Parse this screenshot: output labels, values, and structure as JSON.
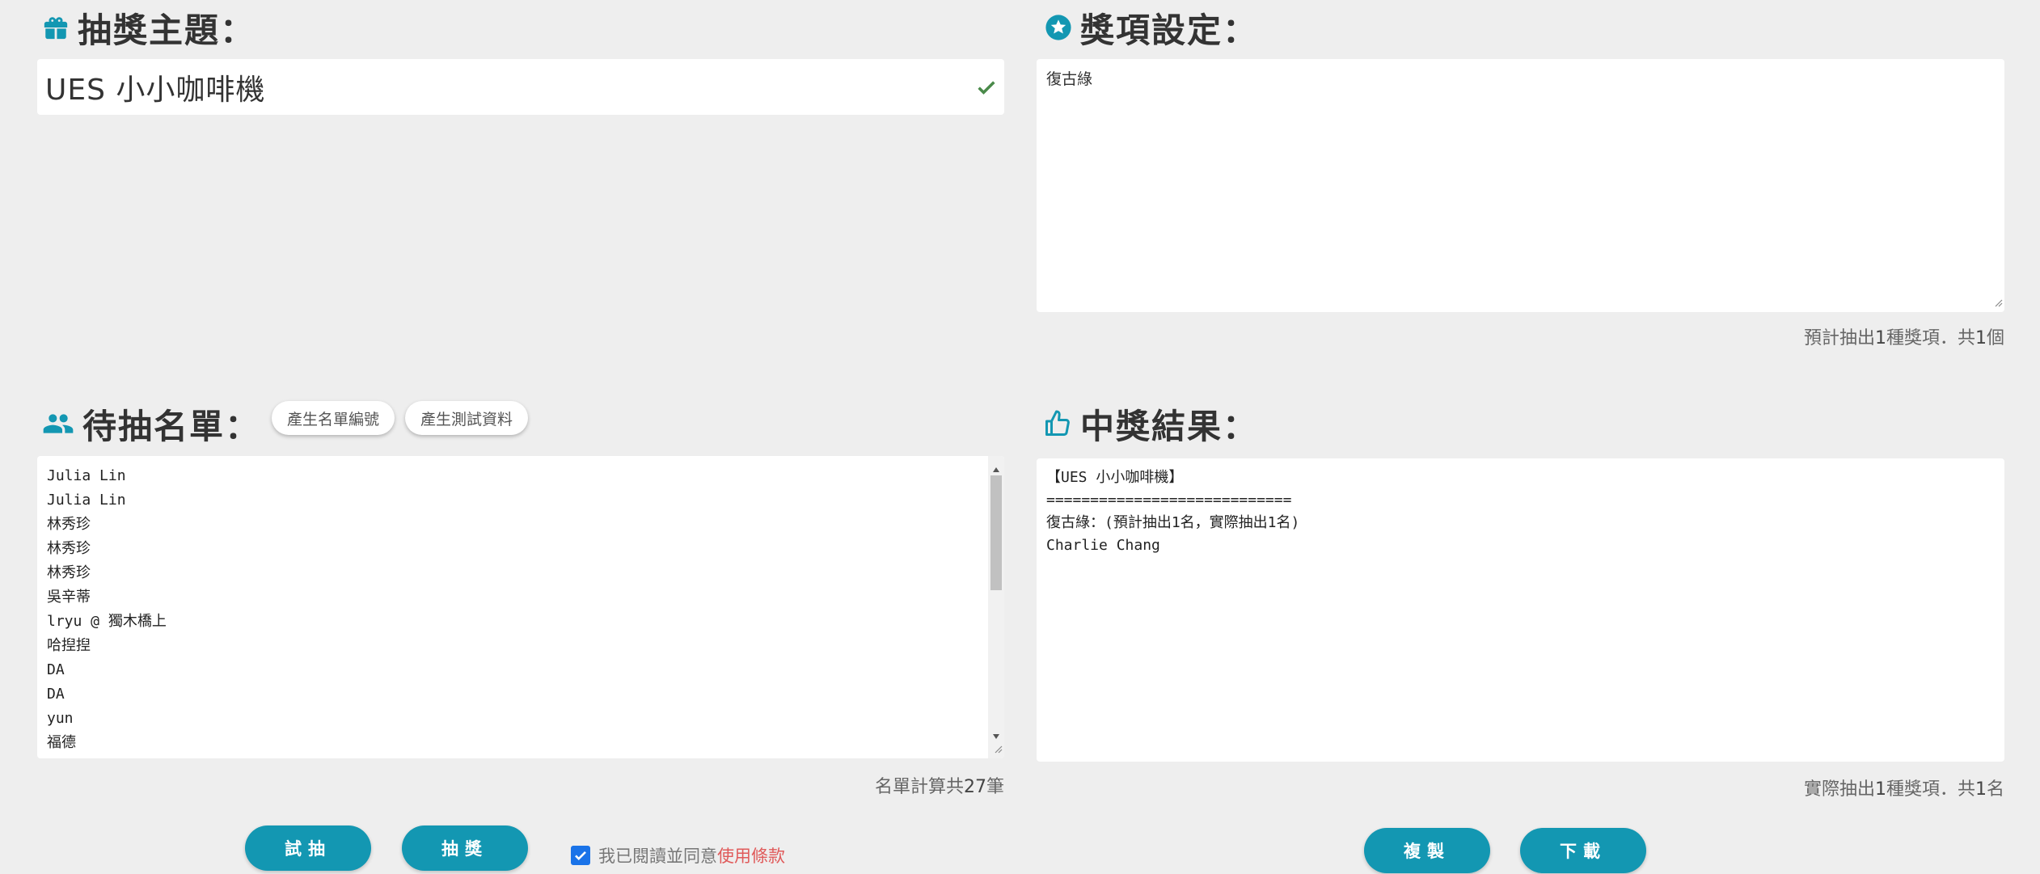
{
  "topic": {
    "heading": "抽獎主題：",
    "value": "UES 小小咖啡機"
  },
  "prizes": {
    "heading": "獎項設定：",
    "text": "復古綠",
    "summary_pre": "預計抽出",
    "summary_kinds": "1",
    "summary_mid": "種獎項．共",
    "summary_count": "1",
    "summary_post": "個"
  },
  "candidates": {
    "heading": "待抽名單：",
    "gen_numbers_label": "產生名單編號",
    "gen_test_label": "產生測試資料",
    "items": [
      "Julia Lin",
      "Julia Lin",
      "林秀珍",
      "林秀珍",
      "林秀珍",
      "吳辛蒂",
      "lryu @ 獨木橋上",
      "哈揑揑",
      "DA",
      "DA",
      "yun",
      "福德"
    ],
    "count_pre": "名單計算共",
    "count": "27",
    "count_post": "筆"
  },
  "results": {
    "heading": "中獎結果：",
    "lines": [
      "【UES 小小咖啡機】",
      "============================",
      "復古綠：(預計抽出1名，實際抽出1名)",
      "Charlie Chang"
    ],
    "summary_pre": "實際抽出",
    "summary_kinds": "1",
    "summary_mid": "種獎項．共",
    "summary_count": "1",
    "summary_post": "名"
  },
  "actions": {
    "trial_label": "試抽",
    "draw_label": "抽獎",
    "agree_text": "我已閱讀並同意",
    "terms_link": "使用條款",
    "agree_checked": true,
    "copy_label": "複製",
    "download_label": "下載"
  },
  "colors": {
    "accent": "#1397b2",
    "check": "#4a8a4a",
    "link": "#e05a5a"
  }
}
